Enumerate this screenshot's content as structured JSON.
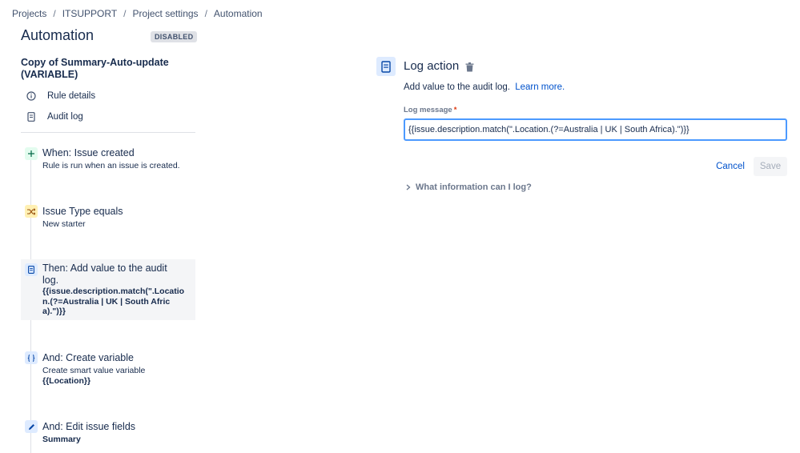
{
  "breadcrumb": [
    "Projects",
    "ITSUPPORT",
    "Project settings",
    "Automation"
  ],
  "breadcrumb_sep": "/",
  "page": {
    "title": "Automation",
    "status": "DISABLED"
  },
  "rule": {
    "name": "Copy of Summary-Auto-update (VARIABLE)"
  },
  "nav": {
    "rule_details": "Rule details",
    "audit_log": "Audit log"
  },
  "components": [
    {
      "title": "When: Issue created",
      "subtitle": "Rule is run when an issue is created.",
      "icon": "plus-icon"
    },
    {
      "title": "Issue Type equals",
      "subtitle": "New starter",
      "icon": "shuffle-icon"
    },
    {
      "title": "Then: Add value to the audit log.",
      "detail": "{{issue.description.match(\".Location.(?=Australia | UK | South Africa).\")}}",
      "icon": "document-icon"
    },
    {
      "title": "And: Create variable",
      "subtitle": "Create smart value variable",
      "detail": "{{Location}}",
      "icon": "braces-icon"
    },
    {
      "title": "And: Edit issue fields",
      "detail": "Summary",
      "icon": "pencil-icon"
    }
  ],
  "panel": {
    "title": "Log action",
    "description": "Add value to the audit log.",
    "learn_more": "Learn more.",
    "field_label": "Log message",
    "required_mark": "*",
    "log_value": "{{issue.description.match(\".Location.(?=Australia | UK | South Africa).\")}}",
    "cancel": "Cancel",
    "save": "Save",
    "expander": "What information can I log?"
  },
  "colors": {
    "link": "#0052cc",
    "focus": "#4c9aff",
    "text": "#172b4d"
  }
}
